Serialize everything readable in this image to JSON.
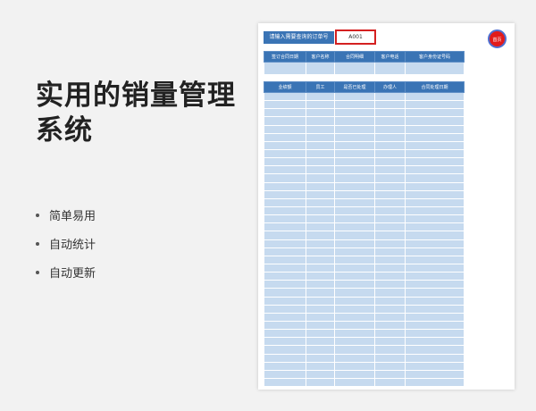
{
  "title": {
    "line1": "实用的销量管理",
    "line2": "系统"
  },
  "features": [
    "简单易用",
    "自动统计",
    "自动更新"
  ],
  "query": {
    "label": "请输入需要查询的订单号",
    "value": "A001"
  },
  "home_button": {
    "label": "首页"
  },
  "info_table": {
    "headers": [
      "签订合同日期",
      "客户名称",
      "合同明细",
      "客户电话",
      "客户身份证号码"
    ]
  },
  "list_table": {
    "headers": [
      "业绩额",
      "员工",
      "是否已处理",
      "办理人",
      "合同处理日期"
    ]
  },
  "colors": {
    "header_blue": "#3a74b5",
    "cell_blue": "#c6daef",
    "home_red": "#e21b1b",
    "input_border": "#d42020"
  }
}
